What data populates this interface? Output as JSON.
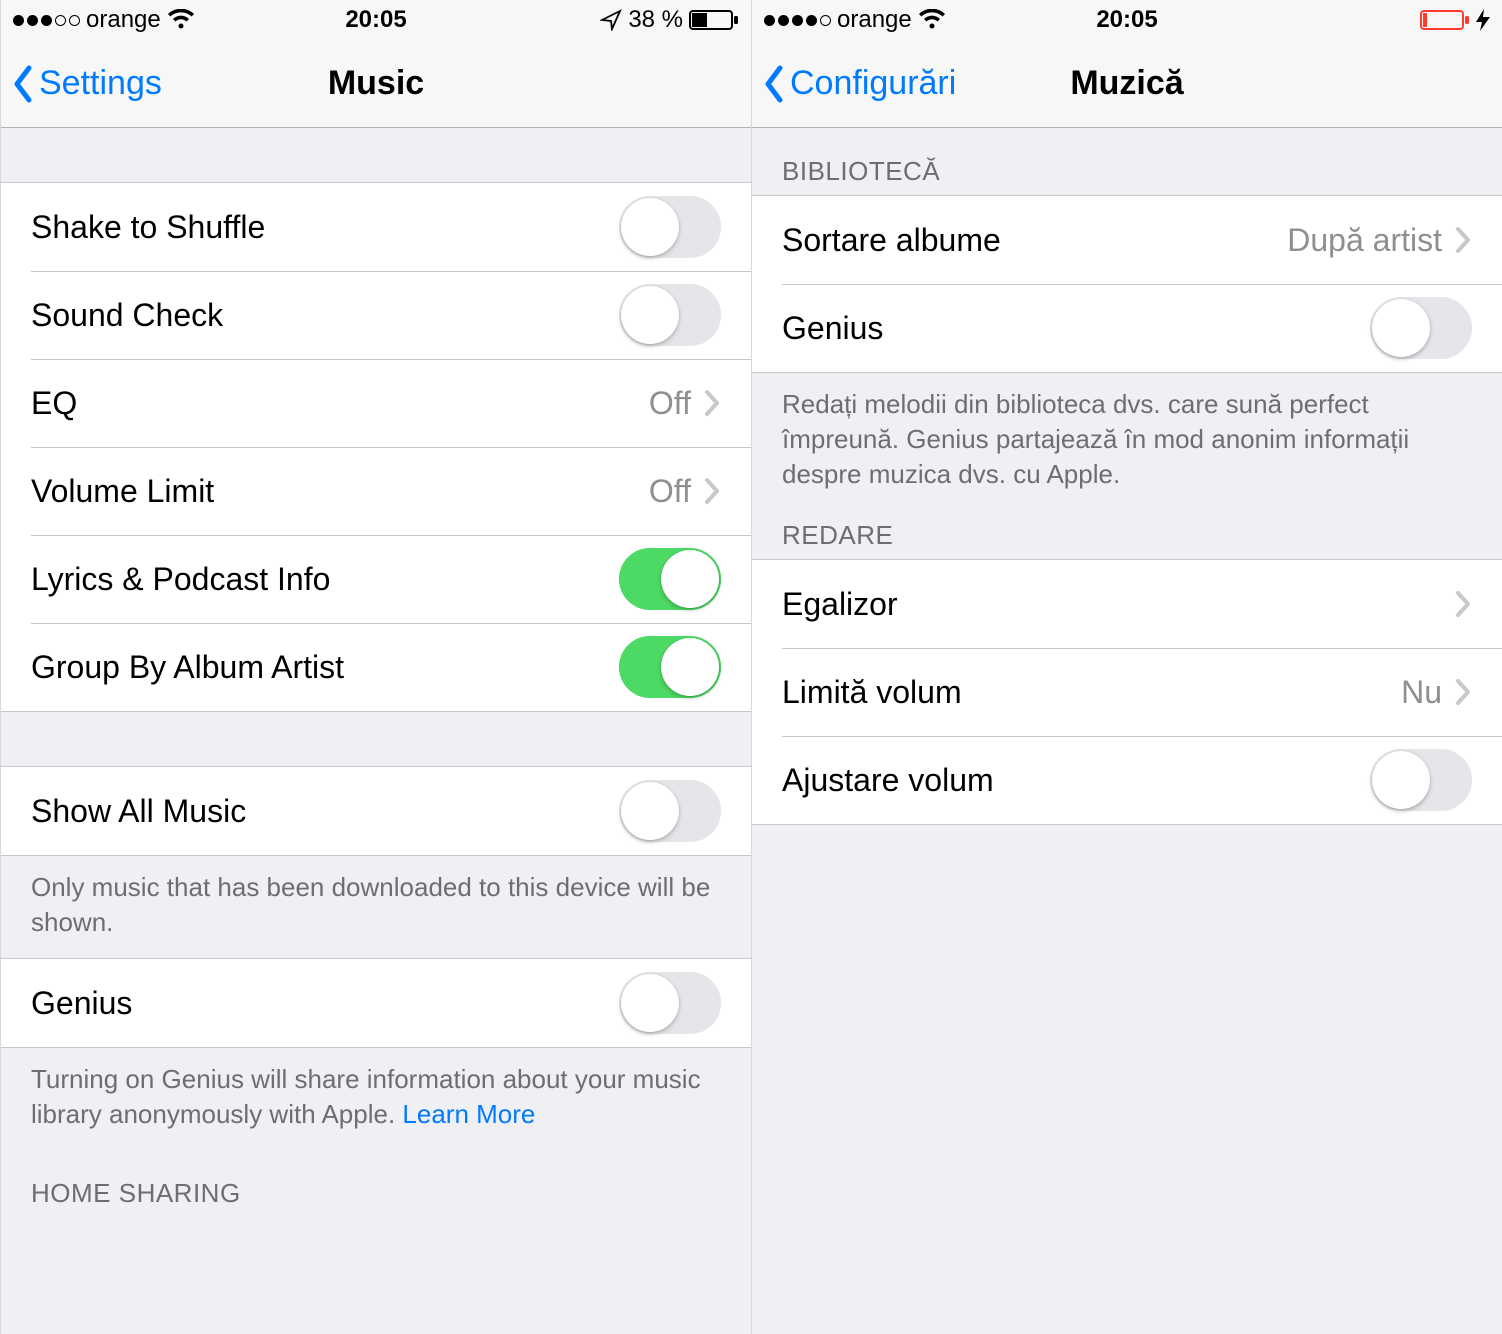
{
  "left": {
    "status": {
      "carrier": "orange",
      "time": "20:05",
      "battery_text": "38 %"
    },
    "nav": {
      "back": "Settings",
      "title": "Music"
    },
    "group1": {
      "shake": "Shake to Shuffle",
      "sound_check": "Sound Check",
      "eq": "EQ",
      "eq_value": "Off",
      "volume_limit": "Volume Limit",
      "volume_limit_value": "Off",
      "lyrics": "Lyrics & Podcast Info",
      "group_by": "Group By Album Artist"
    },
    "group2": {
      "show_all": "Show All Music",
      "show_all_footer": "Only music that has been downloaded to this device will be shown."
    },
    "group3": {
      "genius": "Genius",
      "genius_footer": "Turning on Genius will share information about your music library anonymously with Apple.",
      "learn_more": "Learn More"
    },
    "group4_header": "HOME SHARING"
  },
  "right": {
    "status": {
      "carrier": "orange",
      "time": "20:05"
    },
    "nav": {
      "back": "Configurări",
      "title": "Muzică"
    },
    "section1_header": "BIBLIOTECĂ",
    "section1": {
      "sort_albums": "Sortare albume",
      "sort_albums_value": "După artist",
      "genius": "Genius",
      "genius_footer": "Redați melodii din biblioteca dvs. care sună perfect împreună. Genius partajează în mod anonim informații despre muzica dvs. cu Apple."
    },
    "section2_header": "REDARE",
    "section2": {
      "eq": "Egalizor",
      "volume_limit": "Limită volum",
      "volume_limit_value": "Nu",
      "volume_adjust": "Ajustare volum"
    }
  }
}
